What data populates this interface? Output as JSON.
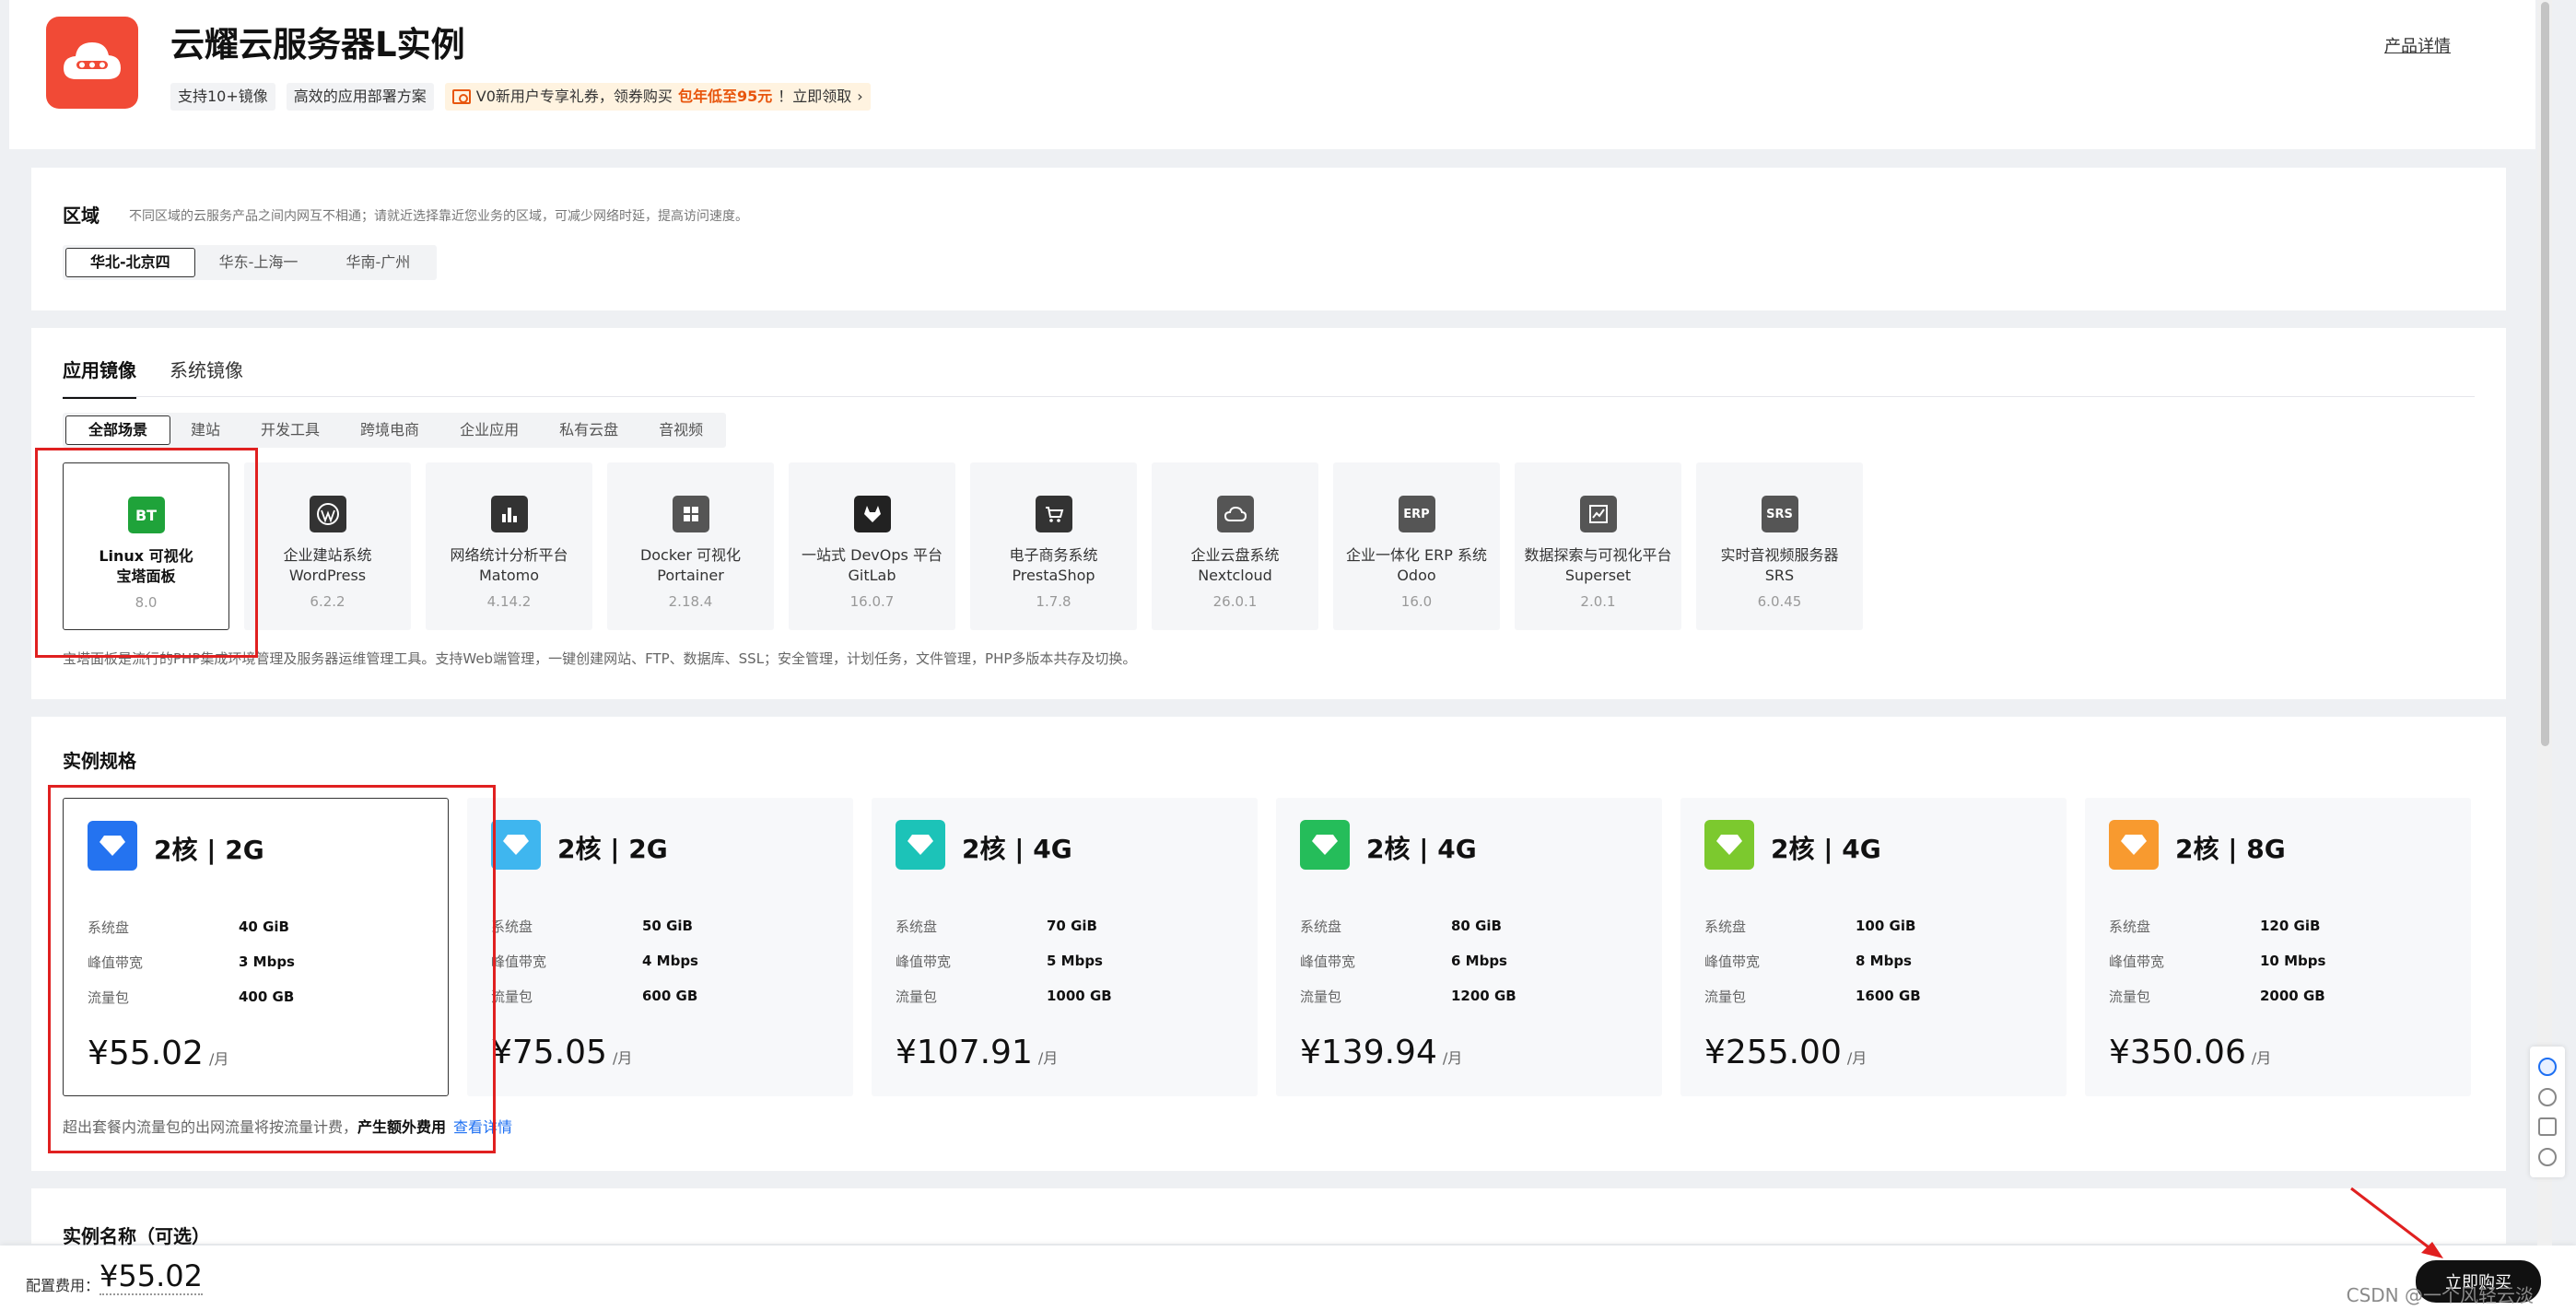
{
  "header": {
    "title": "云耀云服务器L实例",
    "tags": [
      "支持10+镜像",
      "高效的应用部署方案"
    ],
    "promo": {
      "text": "V0新用户专享礼券，领券购买",
      "highlight": "包年低至95元",
      "suffix": "！立即领取"
    },
    "detail_link": "产品详情"
  },
  "region": {
    "title": "区域",
    "hint": "不同区域的云服务产品之间内网互不相通；请就近选择靠近您业务的区域，可减少网络时延，提高访问速度。",
    "options": [
      "华北-北京四",
      "华东-上海一",
      "华南-广州"
    ]
  },
  "images": {
    "tabs": [
      "应用镜像",
      "系统镜像"
    ],
    "filters": [
      "全部场景",
      "建站",
      "开发工具",
      "跨境电商",
      "企业应用",
      "私有云盘",
      "音视频"
    ],
    "cards": [
      {
        "icon": "BT",
        "name1": "Linux 可视化",
        "name2": "宝塔面板",
        "version": "8.0"
      },
      {
        "icon": "WP",
        "name1": "企业建站系统",
        "name2": "WordPress",
        "version": "6.2.2"
      },
      {
        "icon": "M",
        "name1": "网络统计分析平台",
        "name2": "Matomo",
        "version": "4.14.2"
      },
      {
        "icon": "D",
        "name1": "Docker 可视化",
        "name2": "Portainer",
        "version": "2.18.4"
      },
      {
        "icon": "G",
        "name1": "一站式 DevOps 平台",
        "name2": "GitLab",
        "version": "16.0.7"
      },
      {
        "icon": "P",
        "name1": "电子商务系统",
        "name2": "PrestaShop",
        "version": "1.7.8"
      },
      {
        "icon": "N",
        "name1": "企业云盘系统",
        "name2": "Nextcloud",
        "version": "26.0.1"
      },
      {
        "icon": "ERP",
        "name1": "企业一体化 ERP 系统",
        "name2": "Odoo",
        "version": "16.0"
      },
      {
        "icon": "S",
        "name1": "数据探索与可视化平台",
        "name2": "Superset",
        "version": "2.0.1"
      },
      {
        "icon": "SRS",
        "name1": "实时音视频服务器",
        "name2": "SRS",
        "version": "6.0.45"
      }
    ],
    "description": "宝塔面板是流行的PHP集成环境管理及服务器运维管理工具。支持Web端管理，一键创建网站、FTP、数据库、SSL；安全管理，计划任务，文件管理，PHP多版本共存及切换。"
  },
  "specs": {
    "title": "实例规格",
    "labels": {
      "disk": "系统盘",
      "bandwidth": "峰值带宽",
      "traffic": "流量包",
      "unit": "/月"
    },
    "cards": [
      {
        "title": "2核 | 2G",
        "disk": "40 GiB",
        "bandwidth": "3 Mbps",
        "traffic": "400 GB",
        "price": "¥55.02",
        "color": "#2473f0"
      },
      {
        "title": "2核 | 2G",
        "disk": "50 GiB",
        "bandwidth": "4 Mbps",
        "traffic": "600 GB",
        "price": "¥75.05",
        "color": "#3fb6ef"
      },
      {
        "title": "2核 | 4G",
        "disk": "70 GiB",
        "bandwidth": "5 Mbps",
        "traffic": "1000 GB",
        "price": "¥107.91",
        "color": "#1cc3b8"
      },
      {
        "title": "2核 | 4G",
        "disk": "80 GiB",
        "bandwidth": "6 Mbps",
        "traffic": "1200 GB",
        "price": "¥139.94",
        "color": "#25bd5a"
      },
      {
        "title": "2核 | 4G",
        "disk": "100 GiB",
        "bandwidth": "8 Mbps",
        "traffic": "1600 GB",
        "price": "¥255.00",
        "color": "#7cc92e"
      },
      {
        "title": "2核 | 8G",
        "disk": "120 GiB",
        "bandwidth": "10 Mbps",
        "traffic": "2000 GB",
        "price": "¥350.06",
        "color": "#f89a2f"
      }
    ],
    "note": "超出套餐内流量包的出网流量将按流量计费，",
    "note_bold": "产生额外费用",
    "note_link": "查看详情"
  },
  "instance_name": {
    "title": "实例名称（可选）"
  },
  "footer": {
    "fee_label": "配置费用：",
    "fee_value": "¥55.02",
    "buy_label": "立即购买",
    "watermark": "CSDN @一个风轻云淡"
  }
}
